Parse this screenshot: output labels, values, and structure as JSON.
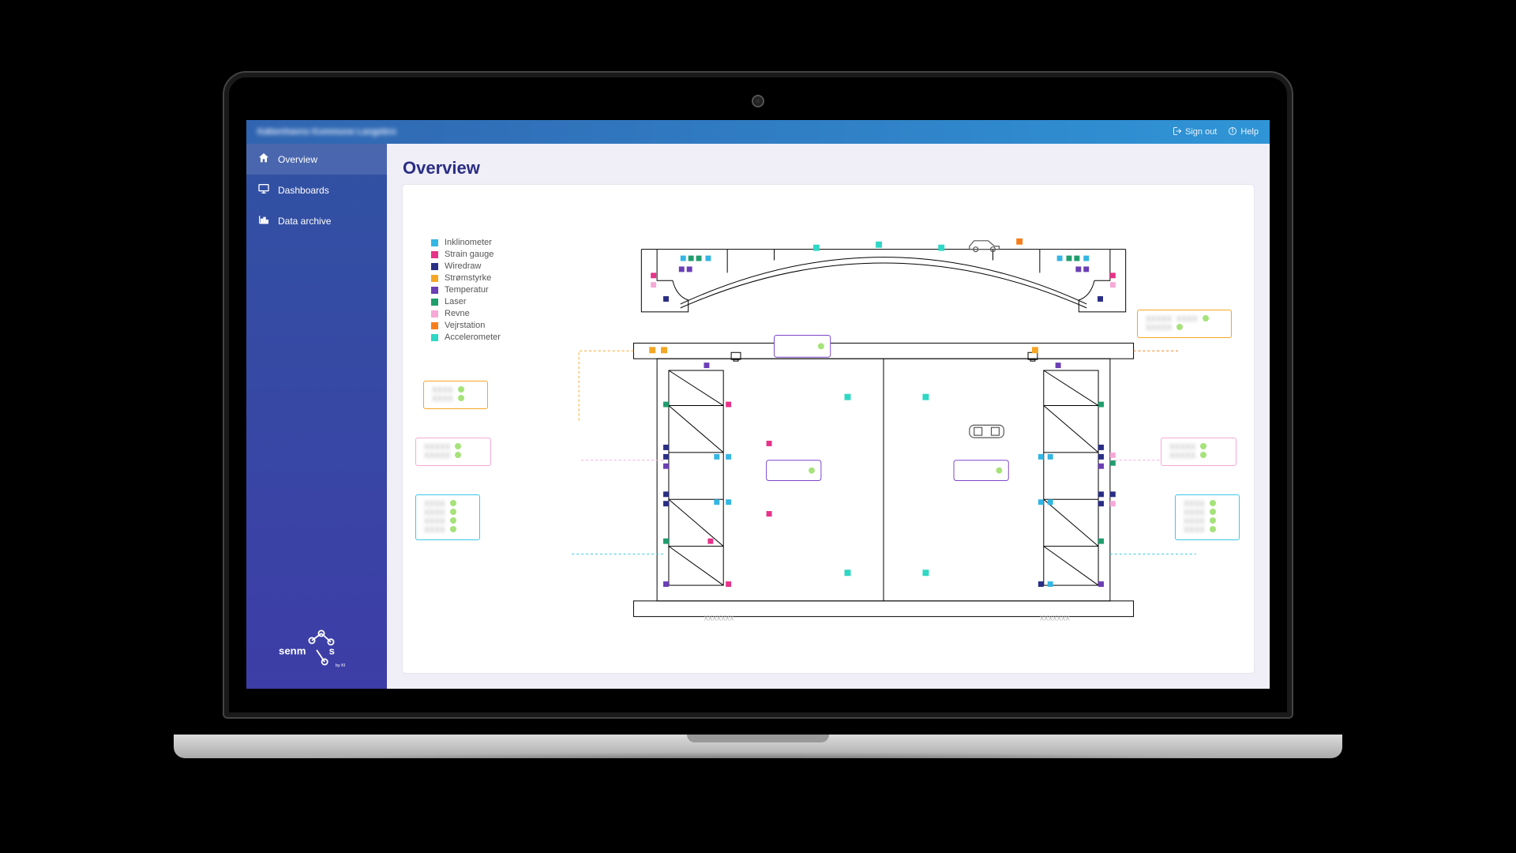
{
  "topbar": {
    "project_title": "Københavns Kommune Langebro",
    "sign_out": "Sign out",
    "help": "Help"
  },
  "sidebar": {
    "items": [
      {
        "label": "Overview",
        "icon": "home",
        "active": true
      },
      {
        "label": "Dashboards",
        "icon": "monitor",
        "active": false
      },
      {
        "label": "Data archive",
        "icon": "chart",
        "active": false
      }
    ],
    "brand": "senmos"
  },
  "page": {
    "title": "Overview"
  },
  "legend": {
    "items": [
      {
        "label": "Inklinometer",
        "color": "#34b6e4"
      },
      {
        "label": "Strain gauge",
        "color": "#e73289"
      },
      {
        "label": "Wiredraw",
        "color": "#2a2e85"
      },
      {
        "label": "Strømstyrke",
        "color": "#f5a623"
      },
      {
        "label": "Temperatur",
        "color": "#6b3fb5"
      },
      {
        "label": "Laser",
        "color": "#1f9e6d"
      },
      {
        "label": "Revne",
        "color": "#f6a9d7"
      },
      {
        "label": "Vejrstation",
        "color": "#f77f1b"
      },
      {
        "label": "Accelerometer",
        "color": "#2fd7c5"
      }
    ]
  },
  "infoboxes": {
    "top_right_orange": {
      "rows": 2
    },
    "top_center_purple": {
      "rows": 1
    },
    "mid_left_purple": {
      "rows": 1
    },
    "mid_right_purple": {
      "rows": 1
    },
    "left_orange_small": {
      "rows": 2
    },
    "left_pink": {
      "rows": 2
    },
    "right_pink": {
      "rows": 2
    },
    "left_cyan": {
      "rows": 4
    },
    "right_cyan": {
      "rows": 4
    }
  },
  "diagram_notes": {
    "top_view": "bridge elevation with sensor markers",
    "plan_view": "bridge plan with sensor markers and vehicle icon"
  }
}
